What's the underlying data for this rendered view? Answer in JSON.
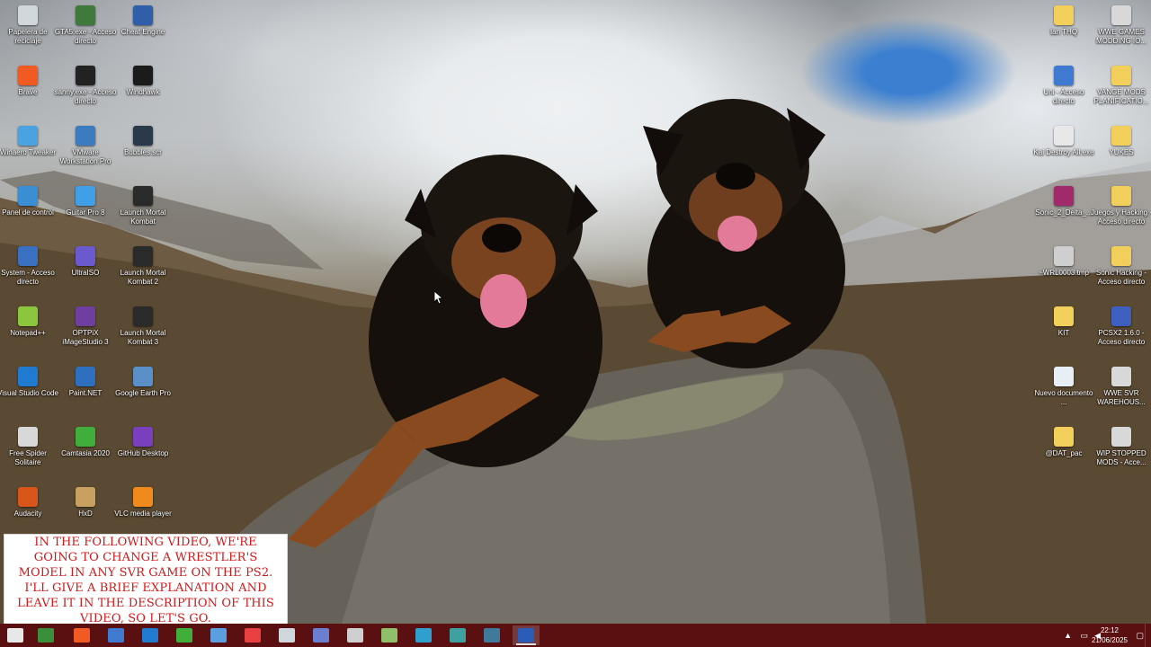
{
  "desktop": {
    "left_icons": [
      {
        "label": "Papelera de reciclaje",
        "icon": "recycle-bin-icon",
        "color": "#cfd6dc"
      },
      {
        "label": "GTA5.exe - Acceso directo",
        "icon": "gta5-icon",
        "color": "#3f7a3a"
      },
      {
        "label": "Cheat Engine",
        "icon": "cheat-engine-icon",
        "color": "#2f5fa8"
      },
      {
        "label": "Brave",
        "icon": "brave-icon",
        "color": "#f25a24"
      },
      {
        "label": "sanny.exe - Acceso directo",
        "icon": "sanny-icon",
        "color": "#222222"
      },
      {
        "label": "Windhawk",
        "icon": "windhawk-icon",
        "color": "#1b1b1b"
      },
      {
        "label": "Winaero Tweaker",
        "icon": "winaero-icon",
        "color": "#4aa3e0"
      },
      {
        "label": "VMware Workstation Pro",
        "icon": "vmware-icon",
        "color": "#3d7bbf"
      },
      {
        "label": "Bubbles.scr",
        "icon": "bubbles-icon",
        "color": "#2b3a4a"
      },
      {
        "label": "Panel de control",
        "icon": "control-panel-icon",
        "color": "#3a8fd4"
      },
      {
        "label": "Guitar Pro 8",
        "icon": "guitar-pro-icon",
        "color": "#3fa0e8"
      },
      {
        "label": "Launch Mortal Kombat",
        "icon": "mortal-kombat-icon",
        "color": "#2a2a2a"
      },
      {
        "label": "System - Acceso directo",
        "icon": "system-icon",
        "color": "#3a70c0"
      },
      {
        "label": "UltraISO",
        "icon": "ultraiso-icon",
        "color": "#6a5acd"
      },
      {
        "label": "Launch Mortal Kombat 2",
        "icon": "mortal-kombat-2-icon",
        "color": "#2a2a2a"
      },
      {
        "label": "Notepad++",
        "icon": "notepad-plus-icon",
        "color": "#8cc63f"
      },
      {
        "label": "OPTPiX iMageStudio 3",
        "icon": "optpix-icon",
        "color": "#6f3fa0"
      },
      {
        "label": "Launch Mortal Kombat 3",
        "icon": "mortal-kombat-3-icon",
        "color": "#2a2a2a"
      },
      {
        "label": "Visual Studio Code",
        "icon": "vscode-icon",
        "color": "#1f7ad0"
      },
      {
        "label": "Paint.NET",
        "icon": "paintnet-icon",
        "color": "#2f6fc0"
      },
      {
        "label": "Google Earth Pro",
        "icon": "google-earth-icon",
        "color": "#5a8fc8"
      },
      {
        "label": "Free Spider Solitaire",
        "icon": "spider-solitaire-icon",
        "color": "#d8d8d8"
      },
      {
        "label": "Camtasia 2020",
        "icon": "camtasia-icon",
        "color": "#3fae3a"
      },
      {
        "label": "GitHub Desktop",
        "icon": "github-desktop-icon",
        "color": "#7a3fbf"
      },
      {
        "label": "Audacity",
        "icon": "audacity-icon",
        "color": "#d8561a"
      },
      {
        "label": "HxD",
        "icon": "hxd-icon",
        "color": "#c8a060"
      },
      {
        "label": "VLC media player",
        "icon": "vlc-icon",
        "color": "#f08a1c"
      }
    ],
    "right_icons": [
      {
        "label": "Ian THQ",
        "icon": "folder-icon",
        "color": "#f2cf5b"
      },
      {
        "label": "WWE GAMES MODDING IO...",
        "icon": "wwe-games-icon",
        "color": "#d8d8d8"
      },
      {
        "label": "Uni - Acceso directo",
        "icon": "uni-shortcut-icon",
        "color": "#3f7ad0"
      },
      {
        "label": "VANGE MODS PLANIFICATIO...",
        "icon": "folder-icon",
        "color": "#f2cf5b"
      },
      {
        "label": "Kai Destroy All.exe",
        "icon": "kai-destroy-icon",
        "color": "#e8e8e8"
      },
      {
        "label": "YUKES",
        "icon": "folder-icon",
        "color": "#f2cf5b"
      },
      {
        "label": "Sonic_2_Delta_...",
        "icon": "winrar-icon",
        "color": "#a02a6a"
      },
      {
        "label": "Juegos y Hacking - Acceso directo",
        "icon": "folder-shortcut-icon",
        "color": "#f2cf5b"
      },
      {
        "label": "~WRL0003.tmp",
        "icon": "tmp-file-icon",
        "color": "#cfcfcf"
      },
      {
        "label": "Sonic Hacking - Acceso directo",
        "icon": "folder-shortcut-icon",
        "color": "#f2cf5b"
      },
      {
        "label": "KIT",
        "icon": "folder-icon",
        "color": "#f2cf5b"
      },
      {
        "label": "PCSX2 1.6.0 - Acceso directo",
        "icon": "pcsx2-icon",
        "color": "#3f5fc0"
      },
      {
        "label": "Nuevo documento ...",
        "icon": "text-document-icon",
        "color": "#e8eef5"
      },
      {
        "label": "WWE SVR WAREHOUS...",
        "icon": "wwe-svr-icon",
        "color": "#d8d8d8"
      },
      {
        "label": "@DAT_pac",
        "icon": "folder-icon",
        "color": "#f2cf5b"
      },
      {
        "label": "WIP STOPPED MODS - Acce...",
        "icon": "wip-mods-icon",
        "color": "#d8d8d8"
      }
    ]
  },
  "caption": {
    "text": "IN THE FOLLOWING VIDEO, WE'RE GOING TO CHANGE A WRESTLER'S MODEL IN ANY SVR GAME ON THE PS2. I'LL GIVE A BRIEF EXPLANATION AND LEAVE IT IN THE DESCRIPTION OF THIS VIDEO, SO LET'S GO."
  },
  "taskbar": {
    "color": "#5a0f10",
    "buttons": [
      {
        "name": "start-icon",
        "color": "#e8e8e8"
      },
      {
        "name": "file-explorer-icon",
        "color": "#3a8f3a"
      },
      {
        "name": "brave-taskbar-icon",
        "color": "#f25a24"
      },
      {
        "name": "app-taskbar-icon",
        "color": "#3f7ad0"
      },
      {
        "name": "vscode-taskbar-icon",
        "color": "#1f7ad0"
      },
      {
        "name": "camtasia-taskbar-icon",
        "color": "#3fae3a"
      },
      {
        "name": "photos-taskbar-icon",
        "color": "#5aa0e0"
      },
      {
        "name": "recorder-taskbar-icon",
        "color": "#e84040"
      },
      {
        "name": "notepad-taskbar-icon",
        "color": "#cfd6dc"
      },
      {
        "name": "paint-taskbar-icon",
        "color": "#6a7fd0"
      },
      {
        "name": "windhawk-taskbar-icon",
        "color": "#cfcfcf"
      },
      {
        "name": "google-earth-taskbar-icon",
        "color": "#8fbf6a"
      },
      {
        "name": "hex-editor-taskbar-icon",
        "color": "#2f9fd0"
      },
      {
        "name": "image-viewer-taskbar-icon",
        "color": "#3fa0a0"
      },
      {
        "name": "gimp-taskbar-icon",
        "color": "#3f7a9a"
      },
      {
        "name": "word-taskbar-icon",
        "color": "#2b5cb8"
      }
    ],
    "tray": {
      "time": "22:12",
      "date": "21/06/2025"
    }
  }
}
